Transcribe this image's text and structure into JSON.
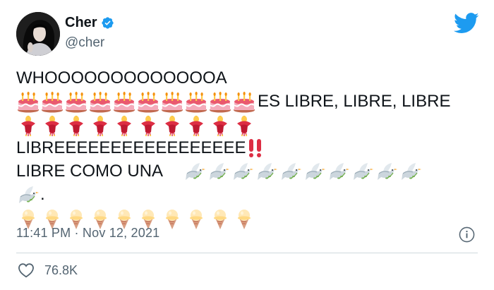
{
  "author": {
    "display_name": "Cher",
    "handle": "@cher",
    "verified": true
  },
  "tweet": {
    "line1": "WHOOOOOOOOOOOOOA",
    "line2_suffix": "ES LIBRE, LIBRE, LIBRE",
    "line4": "LIBREEEEEEEEEEEEEEEEE",
    "line5": "LIBRE COMO UNA",
    "line6_suffix": ".",
    "emoji_rows": {
      "cakes": {
        "icon": "birthday-cake-icon",
        "count": 10
      },
      "fuchsias": {
        "icon": "fuchsia-flower-icon",
        "count": 10
      },
      "doves": {
        "icon": "dove-icon",
        "count": 11
      },
      "ice_creams": {
        "icon": "ice-cream-cone-icon",
        "count": 10
      }
    }
  },
  "footer": {
    "timestamp": "11:41 PM · Nov 12, 2021",
    "like_count": "76.8K"
  },
  "colors": {
    "twitter_blue": "#1d9bf0",
    "secondary_text": "#536471",
    "divider": "#cfd9de"
  }
}
